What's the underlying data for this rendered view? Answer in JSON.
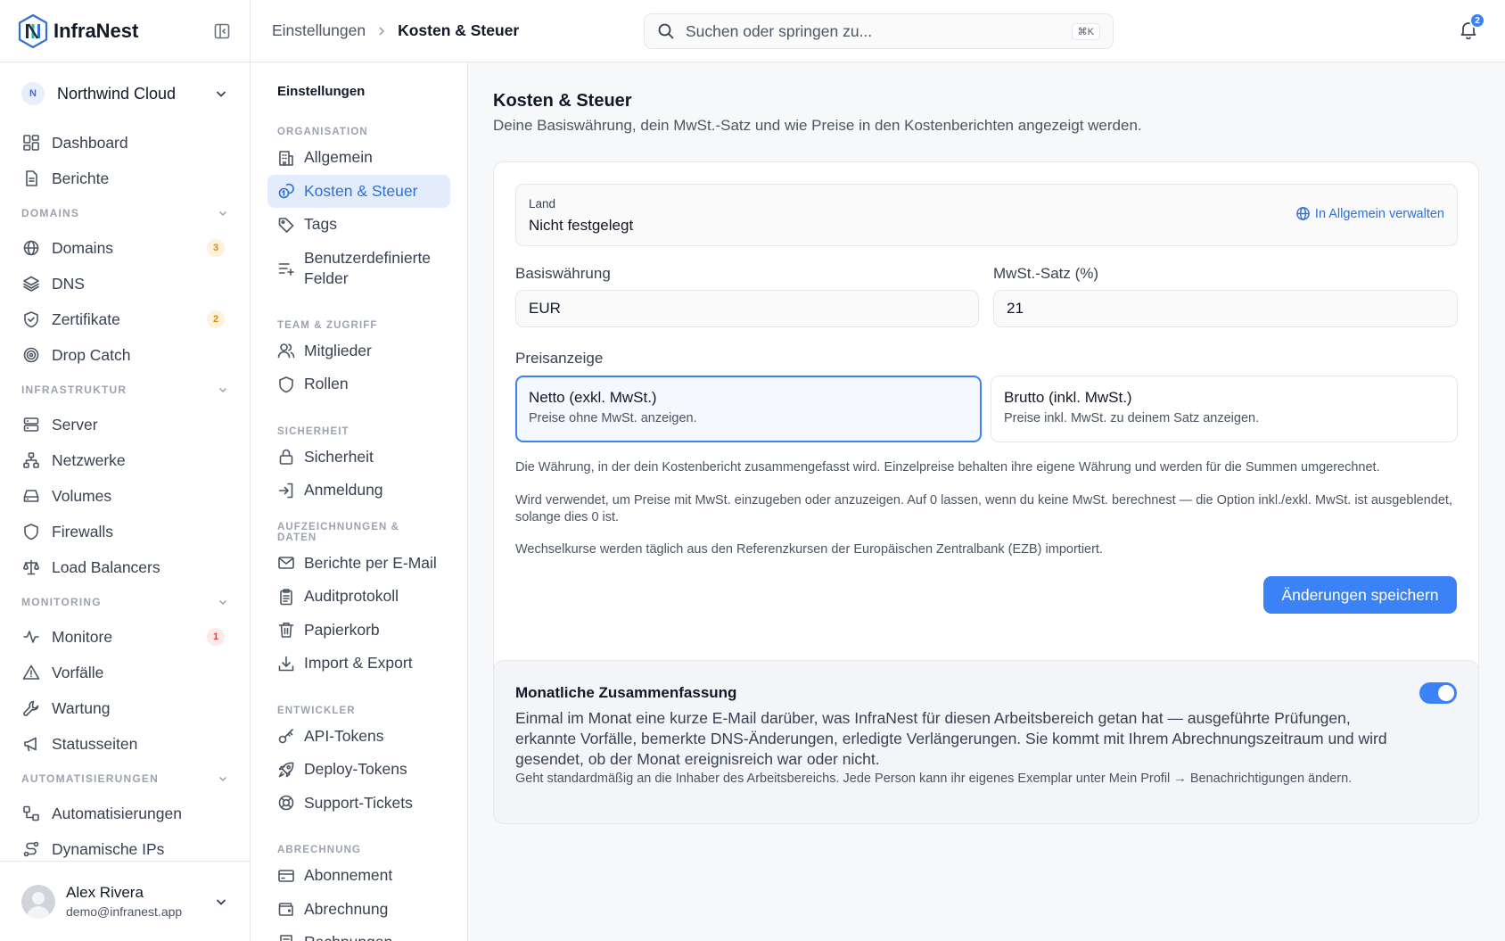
{
  "app": {
    "name": "InfraNest"
  },
  "org": {
    "initial": "N",
    "name": "Northwind Cloud"
  },
  "sidebar": {
    "top": [
      {
        "label": "Dashboard",
        "icon": "dashboard-icon"
      },
      {
        "label": "Berichte",
        "icon": "report-icon"
      }
    ],
    "sections": [
      {
        "title": "DOMAINS",
        "items": [
          {
            "label": "Domains",
            "icon": "globe-icon",
            "badge": "3",
            "badge_color": "amber"
          },
          {
            "label": "DNS",
            "icon": "layers-icon"
          },
          {
            "label": "Zertifikate",
            "icon": "shield-check-icon",
            "badge": "2",
            "badge_color": "amber"
          },
          {
            "label": "Drop Catch",
            "icon": "target-icon"
          }
        ]
      },
      {
        "title": "INFRASTRUKTUR",
        "items": [
          {
            "label": "Server",
            "icon": "server-icon"
          },
          {
            "label": "Netzwerke",
            "icon": "network-icon"
          },
          {
            "label": "Volumes",
            "icon": "drive-icon"
          },
          {
            "label": "Firewalls",
            "icon": "shield-icon"
          },
          {
            "label": "Load Balancers",
            "icon": "scale-icon"
          }
        ]
      },
      {
        "title": "MONITORING",
        "items": [
          {
            "label": "Monitore",
            "icon": "activity-icon",
            "badge": "1",
            "badge_color": "red"
          },
          {
            "label": "Vorfälle",
            "icon": "alert-triangle-icon"
          },
          {
            "label": "Wartung",
            "icon": "wrench-icon"
          },
          {
            "label": "Statusseiten",
            "icon": "megaphone-icon"
          }
        ]
      },
      {
        "title": "AUTOMATISIERUNGEN",
        "items": [
          {
            "label": "Automatisierungen",
            "icon": "workflow-icon"
          },
          {
            "label": "Dynamische IPs",
            "icon": "route-icon"
          }
        ]
      }
    ]
  },
  "user": {
    "name": "Alex Rivera",
    "email": "demo@infranest.app"
  },
  "topbar": {
    "breadcrumb": [
      "Einstellungen",
      "Kosten & Steuer"
    ],
    "search_placeholder": "Suchen oder springen zu...",
    "search_shortcut": "⌘K",
    "notification_count": "2"
  },
  "settings_nav": {
    "title": "Einstellungen",
    "sections": [
      {
        "title": "ORGANISATION",
        "items": [
          {
            "label": "Allgemein",
            "icon": "building-icon"
          },
          {
            "label": "Kosten & Steuer",
            "icon": "coins-icon",
            "active": true
          },
          {
            "label": "Tags",
            "icon": "tag-icon"
          },
          {
            "label": "Benutzerdefinierte Felder",
            "icon": "list-plus-icon",
            "tall": true
          }
        ]
      },
      {
        "title": "TEAM & ZUGRIFF",
        "items": [
          {
            "label": "Mitglieder",
            "icon": "users-icon"
          },
          {
            "label": "Rollen",
            "icon": "shield-icon"
          }
        ]
      },
      {
        "title": "SICHERHEIT",
        "items": [
          {
            "label": "Sicherheit",
            "icon": "lock-icon"
          },
          {
            "label": "Anmeldung",
            "icon": "log-in-icon"
          }
        ]
      },
      {
        "title": "AUFZEICHNUNGEN & DATEN",
        "items": [
          {
            "label": "Berichte per E-Mail",
            "icon": "mail-icon"
          },
          {
            "label": "Auditprotokoll",
            "icon": "clipboard-icon"
          },
          {
            "label": "Papierkorb",
            "icon": "trash-icon"
          },
          {
            "label": "Import & Export",
            "icon": "download-icon"
          }
        ]
      },
      {
        "title": "ENTWICKLER",
        "items": [
          {
            "label": "API-Tokens",
            "icon": "key-icon"
          },
          {
            "label": "Deploy-Tokens",
            "icon": "rocket-icon"
          },
          {
            "label": "Support-Tickets",
            "icon": "lifebuoy-icon"
          }
        ]
      },
      {
        "title": "ABRECHNUNG",
        "items": [
          {
            "label": "Abonnement",
            "icon": "credit-card-icon"
          },
          {
            "label": "Abrechnung",
            "icon": "wallet-icon"
          },
          {
            "label": "Rechnungen",
            "icon": "receipt-icon"
          }
        ]
      }
    ]
  },
  "main": {
    "title": "Kosten & Steuer",
    "subtitle": "Deine Basiswährung, dein MwSt.-Satz und wie Preise in den Kostenberichten angezeigt werden.",
    "country": {
      "label": "Land",
      "value": "Nicht festgelegt",
      "link": "In Allgemein verwalten"
    },
    "currency": {
      "label": "Basiswährung",
      "value": "EUR"
    },
    "vat": {
      "label": "MwSt.-Satz (%)",
      "value": "21"
    },
    "price_display": {
      "label": "Preisanzeige",
      "options": [
        {
          "title": "Netto (exkl. MwSt.)",
          "desc": "Preise ohne MwSt. anzeigen.",
          "selected": true
        },
        {
          "title": "Brutto (inkl. MwSt.)",
          "desc": "Preise inkl. MwSt. zu deinem Satz anzeigen.",
          "selected": false
        }
      ]
    },
    "help": [
      "Die Währung, in der dein Kostenbericht zusammengefasst wird. Einzelpreise behalten ihre eigene Währung und werden für die Summen umgerechnet.",
      "Wird verwendet, um Preise mit MwSt. einzugeben oder anzuzeigen. Auf 0 lassen, wenn du keine MwSt. berechnest — die Option inkl./exkl. MwSt. ist ausgeblendet, solange dies 0 ist.",
      "Wechselkurse werden täglich aus den Referenzkursen der Europäischen Zentralbank (EZB) importiert."
    ],
    "save_label": "Änderungen speichern",
    "monthly": {
      "title": "Monatliche Zusammenfassung",
      "desc": "Einmal im Monat eine kurze E-Mail darüber, was InfraNest für diesen Arbeitsbereich getan hat — ausgeführte Prüfungen, erkannte Vorfälle, bemerkte DNS-Änderungen, erledigte Verlängerungen. Sie kommt mit Ihrem Abrechnungszeitraum und wird gesendet, ob der Monat ereignisreich war oder nicht.",
      "note": "Geht standardmäßig an die Inhaber des Arbeitsbereichs. Jede Person kann ihr eigenes Exemplar unter Mein Profil → Benachrichtigungen ändern.",
      "enabled": true
    }
  }
}
